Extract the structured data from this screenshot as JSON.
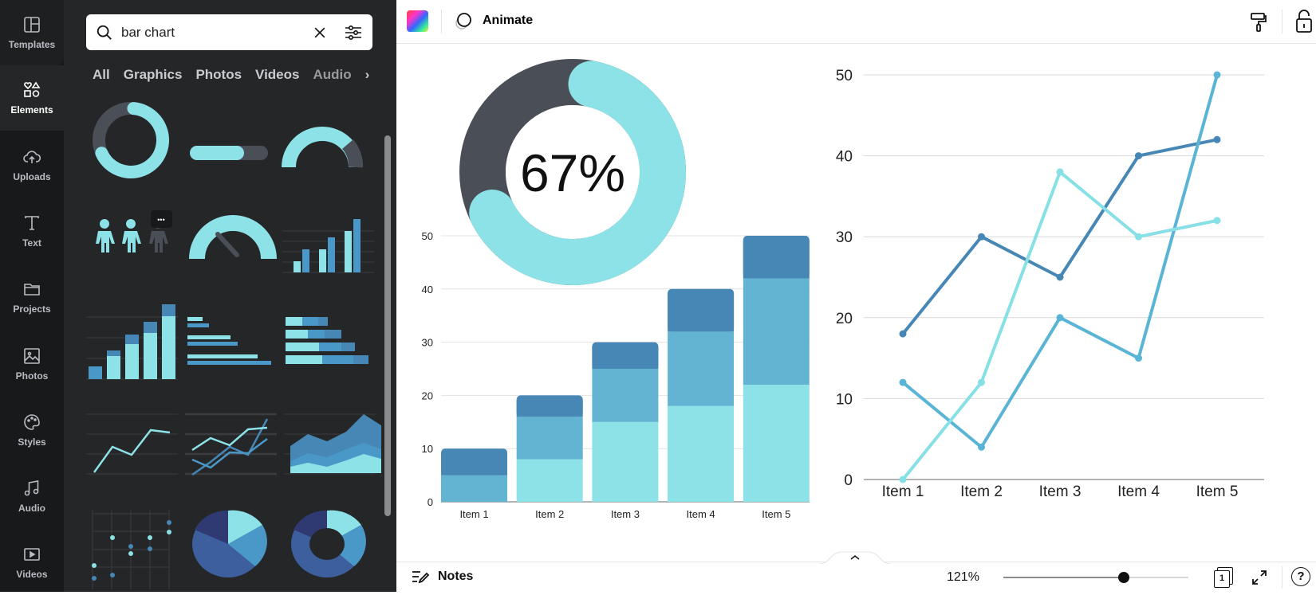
{
  "rail": [
    {
      "label": "Templates",
      "icon": "templates-icon"
    },
    {
      "label": "Elements",
      "icon": "elements-icon",
      "active": true
    },
    {
      "label": "Uploads",
      "icon": "upload-cloud-icon"
    },
    {
      "label": "Text",
      "icon": "text-icon"
    },
    {
      "label": "Projects",
      "icon": "folder-icon"
    },
    {
      "label": "Photos",
      "icon": "image-icon"
    },
    {
      "label": "Styles",
      "icon": "palette-icon"
    },
    {
      "label": "Audio",
      "icon": "music-note-icon"
    },
    {
      "label": "Videos",
      "icon": "video-icon"
    }
  ],
  "search": {
    "value": "bar chart",
    "placeholder": ""
  },
  "filter_tabs": [
    "All",
    "Graphics",
    "Photos",
    "Videos",
    "Audio"
  ],
  "thumb_more_label": "•••",
  "toolbar": {
    "animate_label": "Animate"
  },
  "bottombar": {
    "notes_label": "Notes",
    "zoom": "121%",
    "zoom_slider_fraction": 0.65,
    "page_count": "1"
  },
  "colors": {
    "light": "#8ce2e6",
    "mid": "#63b3d3",
    "dark": "#4787b5",
    "gray": "#4a4f57",
    "rail_bg": "#18191b",
    "panel_bg": "#252627"
  },
  "donut": {
    "label": "67%",
    "value": 0.67
  },
  "chart_data": [
    {
      "type": "bar",
      "stacked": true,
      "categories": [
        "Item 1",
        "Item 2",
        "Item 3",
        "Item 4",
        "Item 5"
      ],
      "series": [
        {
          "values": [
            0,
            8,
            15,
            18,
            22
          ],
          "color": "#8ce2e6"
        },
        {
          "values": [
            5,
            8,
            10,
            14,
            20
          ],
          "color": "#63b3d3"
        },
        {
          "values": [
            5,
            4,
            5,
            8,
            8
          ],
          "color": "#4787b5"
        }
      ],
      "yticks": [
        "0",
        "10",
        "20",
        "30",
        "40",
        "50"
      ],
      "ylim": [
        0,
        50
      ],
      "grid": true
    },
    {
      "type": "line",
      "categories": [
        "Item 1",
        "Item 2",
        "Item 3",
        "Item 4",
        "Item 5"
      ],
      "series": [
        {
          "values": [
            18,
            30,
            25,
            40,
            42
          ],
          "color": "#4787b5"
        },
        {
          "values": [
            12,
            4,
            20,
            15,
            50
          ],
          "color": "#5ab4d6"
        },
        {
          "values": [
            0,
            12,
            38,
            30,
            32
          ],
          "color": "#87e0e6"
        }
      ],
      "yticks": [
        "0",
        "10",
        "20",
        "30",
        "40",
        "50"
      ],
      "ylim": [
        0,
        50
      ],
      "grid": true
    }
  ]
}
